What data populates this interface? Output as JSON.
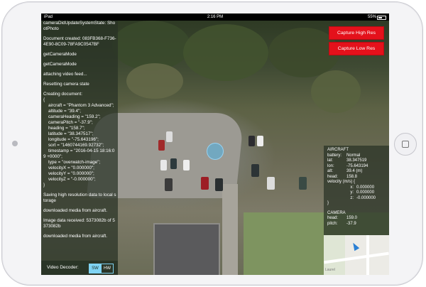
{
  "status_bar": {
    "carrier": "iPad",
    "time": "2:16 PM",
    "battery": "55%"
  },
  "log": [
    "cameraDidUpdateSystemState: ShootPhoto",
    "Document created: 083FB368-F736-4E90-8C09-78FA9C0547BF",
    "getCameraMode",
    "getCameraMode",
    "attaching video feed...",
    "Resetting camera state",
    "Creating document:\n{\n    aircraft = \"Phantom 3 Advanced\";\n    altitude = \"39.4\";\n    cameraHeading = \"159.2\";\n    cameraPitch = \"-37.9\";\n    heading = \"158.7\";\n    latitude = \"38.347517\";\n    longitude = \"-75.643196\";\n    sort = \"1460744169.92732\";\n    timestamp = \"2016-04-15 18:16:09 +0000\";\n    type = \"overwatch-image\";\n    velocityX = \"0.000000\";\n    velocityY = \"0.000000\";\n    velocityZ = \"-0.000000\";\n}",
    "Saving high resolution data to local storage",
    "downloaded media from aircraft.",
    "Image data received: 5373082b of 5373082b",
    "downloaded media from aircraft."
  ],
  "video_decoder": {
    "label": "Video Decoder:",
    "sw": "SW",
    "hw": "HW",
    "selected": "SW"
  },
  "buttons": {
    "capture_high": "Capture High Res",
    "capture_low": "Capture Low Res"
  },
  "aircraft": {
    "title": "AIRCRAFT",
    "battery_label": "battery:",
    "battery": "Normal",
    "lat_label": "lat:",
    "lat": "38.347519",
    "lon_label": "lon:",
    "lon": "-75.643194",
    "alt_label": "alt:",
    "alt": "39.4 (m)",
    "head_label": "head:",
    "head": "158.8",
    "velocity_title": "velocity (m/s) {",
    "x_label": "x:",
    "x": "0.000000",
    "y_label": "y:",
    "y": "0.000000",
    "z_label": "z:",
    "z": "-0.000000",
    "close": "}"
  },
  "camera": {
    "title": "CAMERA",
    "head_label": "head:",
    "head": "159.0",
    "pitch_label": "pitch:",
    "pitch": "-37.9"
  },
  "map": {
    "label": "Laurel"
  },
  "colors": {
    "capture_button": "#e4111b",
    "segment_accent": "#7fd3f3",
    "map_arrow": "#2a7fd4"
  }
}
